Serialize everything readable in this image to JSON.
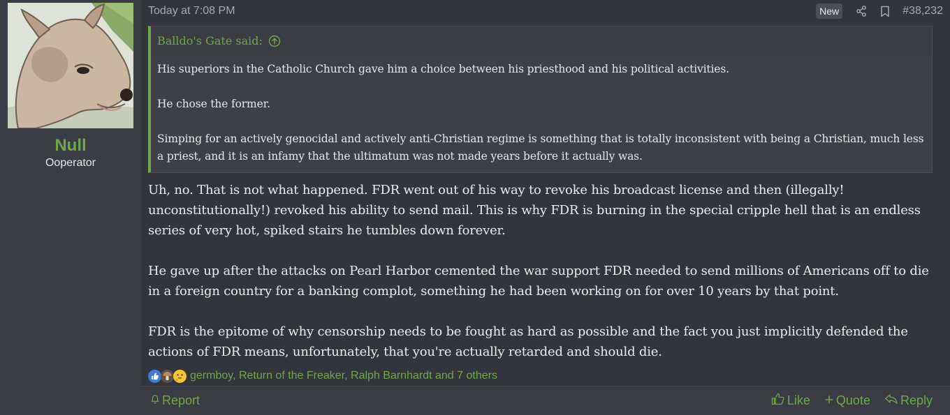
{
  "user": {
    "name": "Null",
    "title": "Ooperator",
    "avatar_icon": "dog-avatar"
  },
  "header": {
    "date": "Today at 7:08 PM",
    "badge": "New",
    "post_number": "#38,232"
  },
  "quote": {
    "author": "Balldo's Gate said:",
    "paragraphs": [
      "His superiors in the Catholic Church gave him a choice between his priesthood and his political activities.",
      "He chose the former.",
      "Simping for an actively genocidal and actively anti-Christian regime is something that is totally inconsistent with being a Christian, much less a priest, and it is an infamy that the ultimatum was not made years before it actually was."
    ]
  },
  "message": {
    "paragraphs": [
      "Uh, no. That is not what happened. FDR went out of his way to revoke his broadcast license and then (illegally! unconstitutionally!) revoked his ability to send mail. This is why FDR is burning in the special cripple hell that is an endless series of very hot, spiked stairs he tumbles down forever.",
      "He gave up after the attacks on Pearl Harbor cemented the war support FDR needed to send millions of Americans off to die in a foreign country for a banking complot, something he had been working on for over 10 years by that point.",
      "FDR is the epitome of why censorship needs to be fought as hard as possible and the fact you just implicitly defended the actions of FDR means, unfortunately, that you're actually retarded and should die."
    ]
  },
  "reactions": {
    "text": "germboy, Return of the Freaker, Ralph Barnhardt and 7 others",
    "icons": [
      "thumbs-up-icon",
      "mushroom-icon",
      "thinking-face-icon"
    ]
  },
  "footer": {
    "report": "Report",
    "like": "Like",
    "quote": "Quote",
    "reply": "Reply"
  },
  "colors": {
    "accent": "#6ea84b",
    "background": "#32353c",
    "sidebar": "#3a3d44",
    "text": "#ececec"
  }
}
